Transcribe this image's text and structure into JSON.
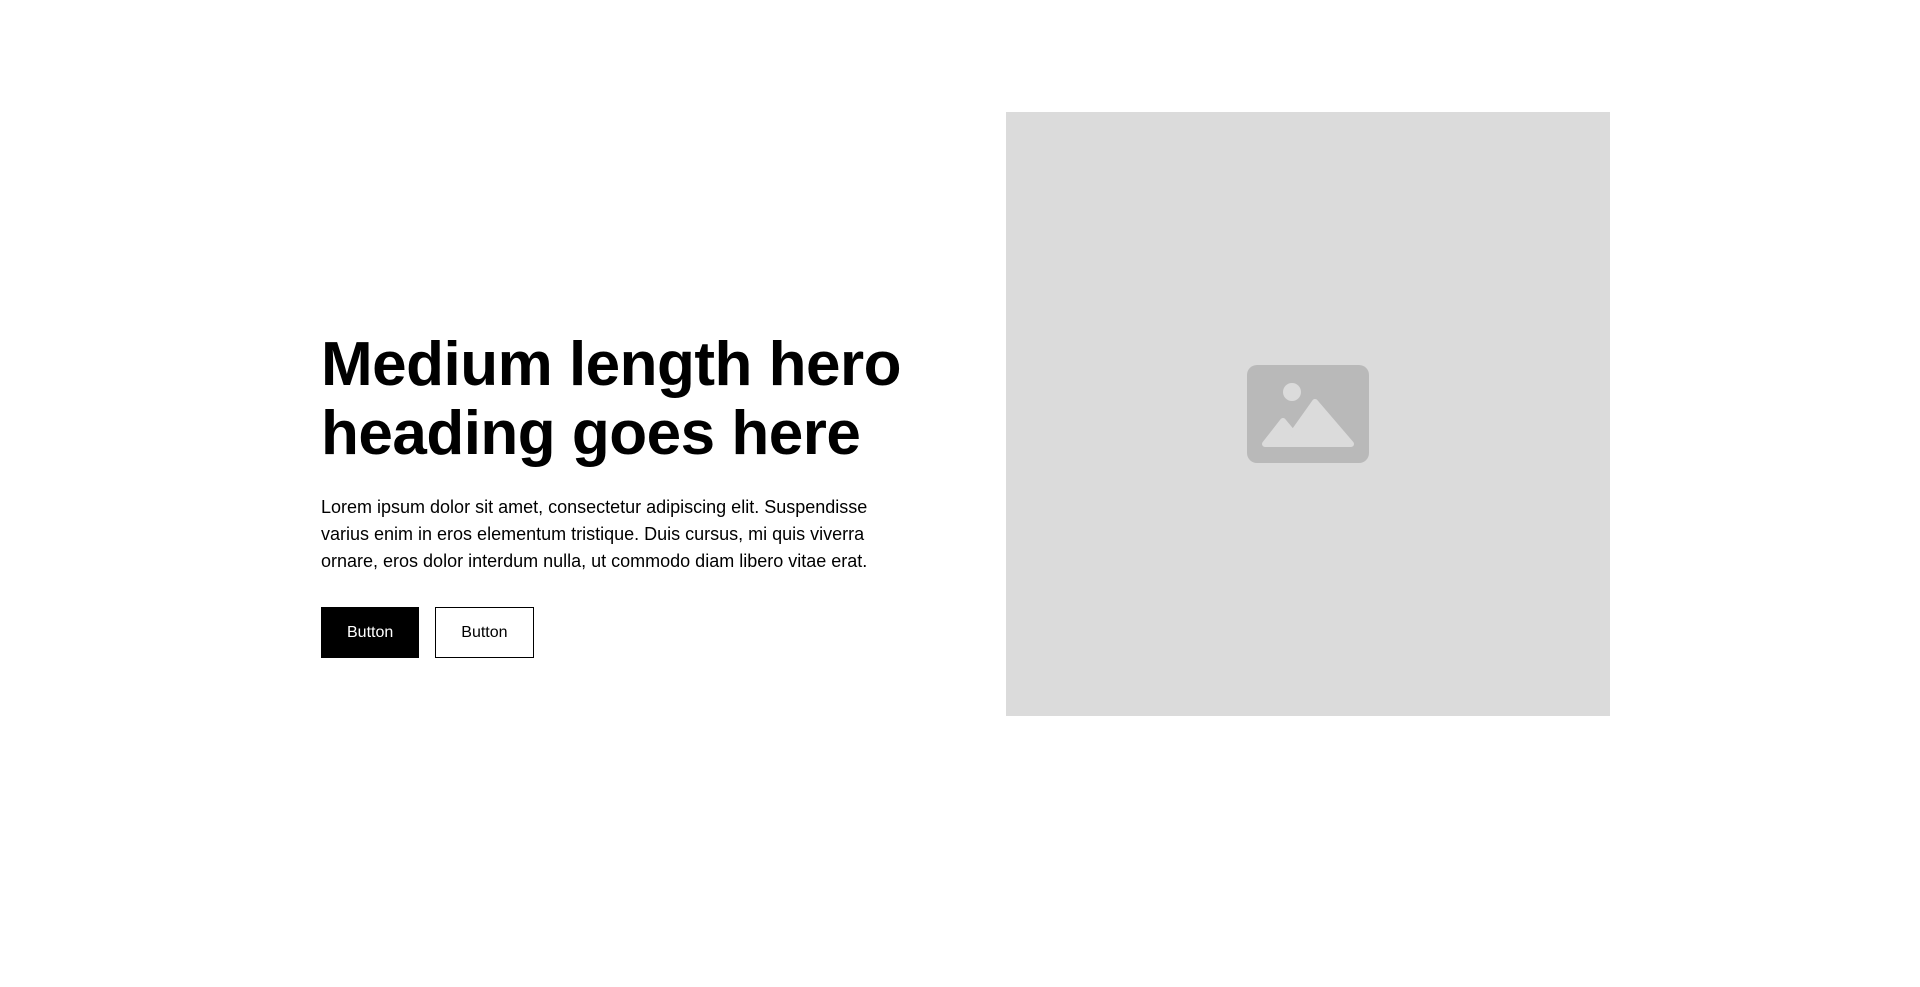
{
  "hero": {
    "heading": "Medium length hero heading goes here",
    "text": "Lorem ipsum dolor sit amet, consectetur adipiscing elit. Suspendisse varius enim in eros elementum tristique. Duis cursus, mi quis viverra ornare, eros dolor interdum nulla, ut commodo diam libero vitae erat.",
    "buttons": [
      {
        "label": "Button"
      },
      {
        "label": "Button"
      }
    ],
    "image": {
      "icon": "image-icon",
      "background_color": "#dbdbdb",
      "icon_color": "#b9b9b9"
    }
  },
  "colors": {
    "primary": "#000000",
    "background": "#ffffff"
  }
}
